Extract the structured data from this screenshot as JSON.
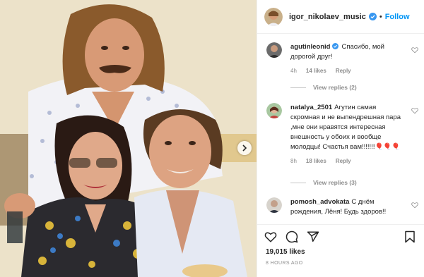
{
  "post": {
    "username": "igor_nikolaev_music",
    "separator": "•",
    "follow_label": "Follow",
    "likes": "19,015 likes",
    "time_ago": "8 HOURS AGO"
  },
  "comments": [
    {
      "username": "agutinleonid",
      "verified": true,
      "text": "Спасибо, мой дорогой друг!",
      "time": "4h",
      "likes": "14 likes",
      "reply_label": "Reply",
      "view_replies": "View replies (2)"
    },
    {
      "username": "natalya_2501",
      "verified": false,
      "text": "Агутин самая скромная и не выпендрешная пара ,мне они нравятся интересная внешность у обоих и вообще молодцы! Счастья вам!!!!!!!🎈🎈🎈",
      "time": "8h",
      "likes": "18 likes",
      "reply_label": "Reply",
      "view_replies": "View replies (3)"
    },
    {
      "username": "pomosh_advokata",
      "verified": false,
      "text": "С днём рождения, Лёня! Будь здоров!!",
      "time": "",
      "likes": "",
      "reply_label": "",
      "view_replies": ""
    }
  ],
  "icons": {
    "verified": "verified-badge-icon",
    "heart": "heart-icon",
    "comment": "comment-icon",
    "share": "share-icon",
    "bookmark": "bookmark-icon",
    "next": "chevron-right-icon"
  },
  "colors": {
    "accent": "#0095f6",
    "text": "#262626",
    "muted": "#8e8e8e",
    "border": "#efefef"
  }
}
